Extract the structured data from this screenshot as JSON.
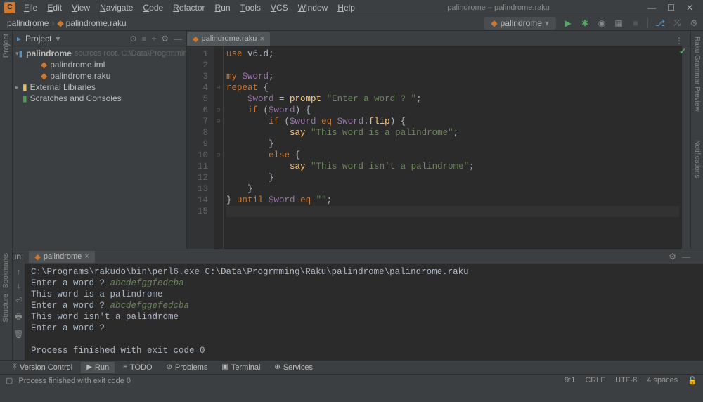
{
  "window": {
    "title": "palindrome – palindrome.raku",
    "logo": "C"
  },
  "menu": [
    "File",
    "Edit",
    "View",
    "Navigate",
    "Code",
    "Refactor",
    "Run",
    "Tools",
    "VCS",
    "Window",
    "Help"
  ],
  "crumbs": {
    "root": "palindrome",
    "file": "palindrome.raku"
  },
  "runconfig": "palindrome",
  "project": {
    "label": "Project",
    "root": "palindrome",
    "root_hint": "sources root, C:\\Data\\Progrmming\\Raku\\pa",
    "files": [
      "palindrome.iml",
      "palindrome.raku"
    ],
    "external": "External Libraries",
    "scratches": "Scratches and Consoles"
  },
  "editor": {
    "tab": "palindrome.raku",
    "lines": [
      {
        "n": 1,
        "seg": [
          {
            "c": "kw",
            "t": "use "
          },
          {
            "c": "txt",
            "t": "v6.d"
          },
          {
            "c": "punc",
            "t": ";"
          }
        ]
      },
      {
        "n": 2,
        "seg": []
      },
      {
        "n": 3,
        "seg": [
          {
            "c": "kw",
            "t": "my "
          },
          {
            "c": "var",
            "t": "$word"
          },
          {
            "c": "punc",
            "t": ";"
          }
        ]
      },
      {
        "n": 4,
        "seg": [
          {
            "c": "kw",
            "t": "repeat"
          },
          {
            "c": "punc",
            "t": " {"
          }
        ]
      },
      {
        "n": 5,
        "seg": [
          {
            "c": "txt",
            "t": "    "
          },
          {
            "c": "var",
            "t": "$word"
          },
          {
            "c": "txt",
            "t": " = "
          },
          {
            "c": "fn",
            "t": "prompt"
          },
          {
            "c": "txt",
            "t": " "
          },
          {
            "c": "str",
            "t": "\"Enter a word ? \""
          },
          {
            "c": "punc",
            "t": ";"
          }
        ]
      },
      {
        "n": 6,
        "seg": [
          {
            "c": "txt",
            "t": "    "
          },
          {
            "c": "kw",
            "t": "if"
          },
          {
            "c": "txt",
            "t": " ("
          },
          {
            "c": "var",
            "t": "$word"
          },
          {
            "c": "punc",
            "t": ") {"
          }
        ]
      },
      {
        "n": 7,
        "seg": [
          {
            "c": "txt",
            "t": "        "
          },
          {
            "c": "kw",
            "t": "if"
          },
          {
            "c": "txt",
            "t": " ("
          },
          {
            "c": "var",
            "t": "$word"
          },
          {
            "c": "txt",
            "t": " "
          },
          {
            "c": "kw",
            "t": "eq"
          },
          {
            "c": "txt",
            "t": " "
          },
          {
            "c": "var",
            "t": "$word"
          },
          {
            "c": "punc",
            "t": "."
          },
          {
            "c": "fn",
            "t": "flip"
          },
          {
            "c": "punc",
            "t": ") {"
          }
        ]
      },
      {
        "n": 8,
        "seg": [
          {
            "c": "txt",
            "t": "            "
          },
          {
            "c": "fn",
            "t": "say"
          },
          {
            "c": "txt",
            "t": " "
          },
          {
            "c": "str",
            "t": "\"This word is a palindrome\""
          },
          {
            "c": "punc",
            "t": ";"
          }
        ]
      },
      {
        "n": 9,
        "seg": [
          {
            "c": "txt",
            "t": "        "
          },
          {
            "c": "punc",
            "t": "}"
          }
        ]
      },
      {
        "n": 10,
        "seg": [
          {
            "c": "txt",
            "t": "        "
          },
          {
            "c": "kw",
            "t": "else"
          },
          {
            "c": "punc",
            "t": " {"
          }
        ]
      },
      {
        "n": 11,
        "seg": [
          {
            "c": "txt",
            "t": "            "
          },
          {
            "c": "fn",
            "t": "say"
          },
          {
            "c": "txt",
            "t": " "
          },
          {
            "c": "str",
            "t": "\"This word isn't a palindrome\""
          },
          {
            "c": "punc",
            "t": ";"
          }
        ]
      },
      {
        "n": 12,
        "seg": [
          {
            "c": "txt",
            "t": "        "
          },
          {
            "c": "punc",
            "t": "}"
          }
        ]
      },
      {
        "n": 13,
        "seg": [
          {
            "c": "txt",
            "t": "    "
          },
          {
            "c": "punc",
            "t": "}"
          }
        ]
      },
      {
        "n": 14,
        "seg": [
          {
            "c": "punc",
            "t": "} "
          },
          {
            "c": "kw",
            "t": "until"
          },
          {
            "c": "txt",
            "t": " "
          },
          {
            "c": "var",
            "t": "$word"
          },
          {
            "c": "txt",
            "t": " "
          },
          {
            "c": "kw",
            "t": "eq"
          },
          {
            "c": "txt",
            "t": " "
          },
          {
            "c": "str",
            "t": "\"\""
          },
          {
            "c": "punc",
            "t": ";"
          }
        ]
      },
      {
        "n": 15,
        "seg": [],
        "cursor": true
      }
    ]
  },
  "run": {
    "tab_label": "Run:",
    "tab": "palindrome",
    "console": [
      {
        "seg": [
          {
            "c": "txt",
            "t": "C:\\Programs\\rakudo\\bin\\perl6.exe C:\\Data\\Progrmming\\Raku\\palindrome\\palindrome.raku"
          }
        ]
      },
      {
        "seg": [
          {
            "c": "txt",
            "t": "Enter a word ? "
          },
          {
            "c": "inptxt",
            "t": "abcdefggfedcba"
          }
        ]
      },
      {
        "seg": [
          {
            "c": "txt",
            "t": "This word is a palindrome"
          }
        ]
      },
      {
        "seg": [
          {
            "c": "txt",
            "t": "Enter a word ? "
          },
          {
            "c": "inptxt",
            "t": "abcdefggefedcba"
          }
        ]
      },
      {
        "seg": [
          {
            "c": "txt",
            "t": "This word isn't a palindrome"
          }
        ]
      },
      {
        "seg": [
          {
            "c": "txt",
            "t": "Enter a word ? "
          }
        ]
      },
      {
        "seg": []
      },
      {
        "seg": [
          {
            "c": "txt",
            "t": "Process finished with exit code 0"
          }
        ]
      }
    ]
  },
  "bottombar": {
    "vc": "Version Control",
    "run": "Run",
    "todo": "TODO",
    "problems": "Problems",
    "terminal": "Terminal",
    "services": "Services"
  },
  "status": {
    "msg": "Process finished with exit code 0",
    "pos": "9:1",
    "eol": "CRLF",
    "enc": "UTF-8",
    "indent": "4 spaces"
  },
  "side_right": {
    "grammar": "Raku Grammar Preview",
    "notif": "Notifications"
  },
  "side_left": {
    "bookmarks": "Bookmarks",
    "structure": "Structure"
  }
}
